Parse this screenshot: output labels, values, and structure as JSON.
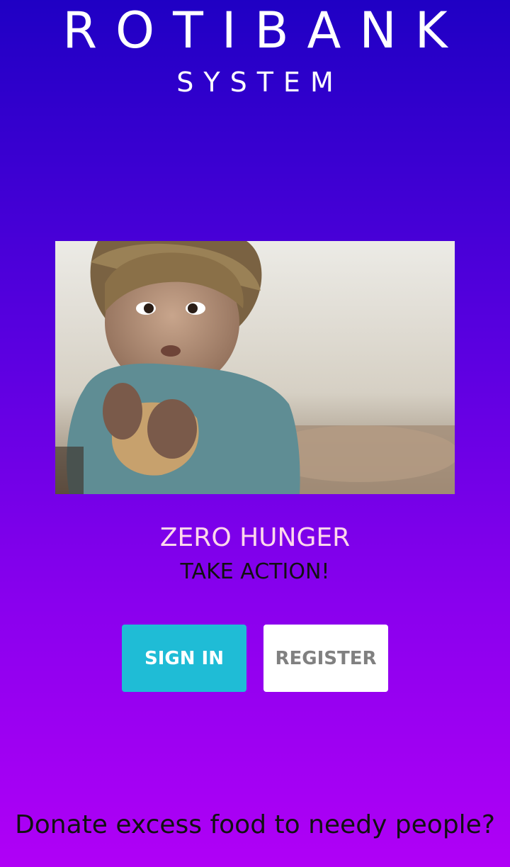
{
  "header": {
    "title": "ROTIBANK",
    "subtitle": "SYSTEM"
  },
  "hero": {
    "headline": "ZERO HUNGER",
    "tagline": "TAKE ACTION!"
  },
  "actions": {
    "sign_in_label": "SIGN IN",
    "register_label": "REGISTER"
  },
  "footer": {
    "question": "Donate excess food to needy people?"
  },
  "colors": {
    "background_top": "#1f00c4",
    "background_bottom": "#b000f6",
    "sign_in_button": "#1fbcd6",
    "register_button": "#ffffff",
    "headline_text": "#ffd7ec"
  }
}
